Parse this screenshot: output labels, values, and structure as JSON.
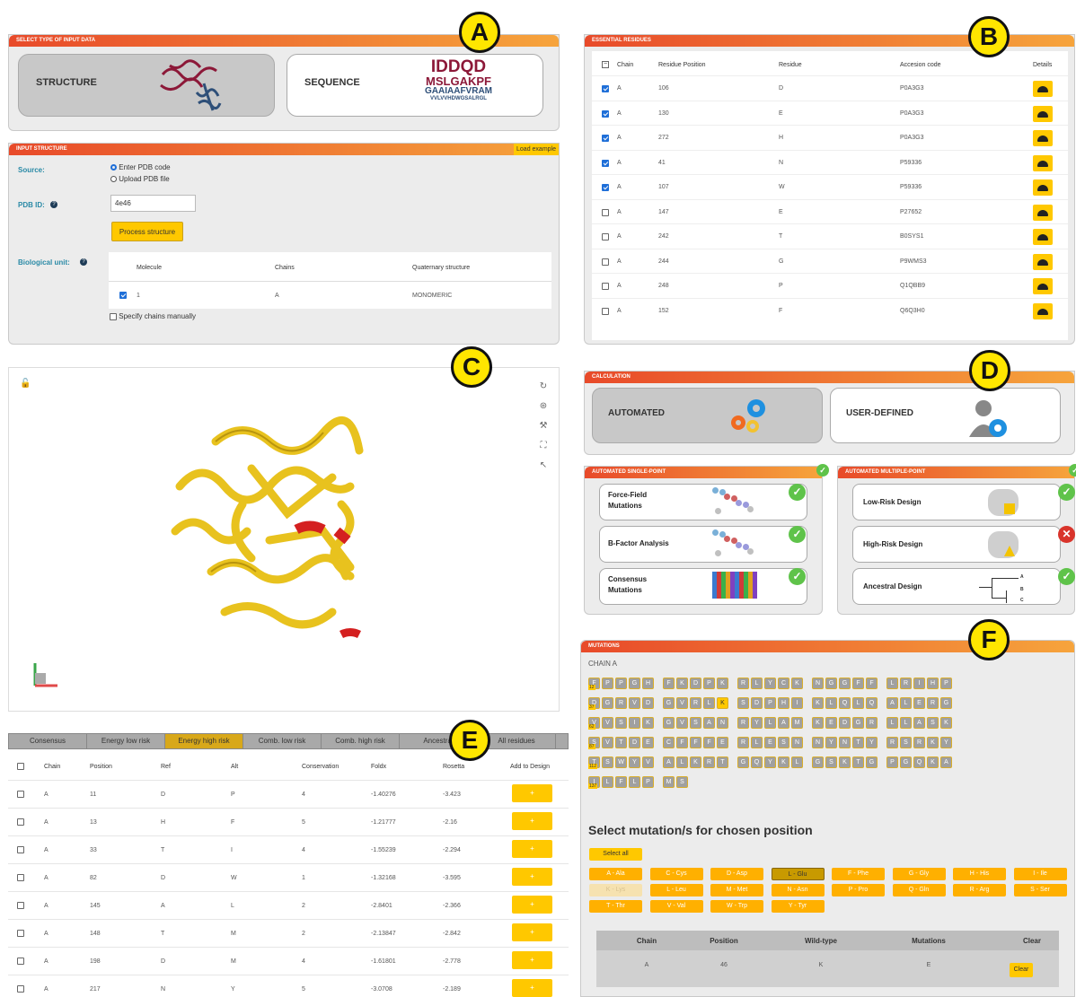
{
  "labels": {
    "a": "A",
    "b": "B",
    "c": "C",
    "d": "D",
    "e": "E",
    "f": "F"
  },
  "panelA": {
    "header": "SELECT TYPE OF INPUT DATA",
    "structure_label": "STRUCTURE",
    "sequence_label": "SEQUENCE",
    "seq_lines": [
      "IDDQD",
      "MSLGAKPF",
      "GAAIAAFVRAM",
      "VVLVVHDWGSALRGL"
    ]
  },
  "input": {
    "header": "INPUT STRUCTURE",
    "load_example": "Load example",
    "source_label": "Source:",
    "opt_pdb": "Enter PDB code",
    "opt_upload": "Upload PDB file",
    "pdb_label": "PDB ID:",
    "pdb_value": "4e46",
    "process_btn": "Process structure",
    "bio_label": "Biological unit:",
    "cols": [
      "Molecule",
      "Chains",
      "Quaternary structure"
    ],
    "row": [
      "1",
      "A",
      "MONOMERIC"
    ],
    "specify": "Specify chains manually"
  },
  "essential": {
    "header": "ESSENTIAL RESIDUES",
    "cols": [
      "Chain",
      "Residue Position",
      "Residue",
      "Accesion code",
      "Details"
    ],
    "rows": [
      [
        "A",
        "106",
        "D",
        "P0A3G3",
        true
      ],
      [
        "A",
        "130",
        "E",
        "P0A3G3",
        true
      ],
      [
        "A",
        "272",
        "H",
        "P0A3G3",
        true
      ],
      [
        "A",
        "41",
        "N",
        "P59336",
        true
      ],
      [
        "A",
        "107",
        "W",
        "P59336",
        true
      ],
      [
        "A",
        "147",
        "E",
        "P27652",
        false
      ],
      [
        "A",
        "242",
        "T",
        "B0SYS1",
        false
      ],
      [
        "A",
        "244",
        "G",
        "P9WMS3",
        false
      ],
      [
        "A",
        "248",
        "P",
        "Q1QBB9",
        false
      ],
      [
        "A",
        "152",
        "F",
        "Q6Q3H0",
        false
      ]
    ]
  },
  "calc": {
    "header": "CALCULATION",
    "automated": "AUTOMATED",
    "user": "USER-DEFINED",
    "single_header": "AUTOMATED SINGLE-POINT",
    "multi_header": "AUTOMATED MULTIPLE-POINT",
    "single": [
      [
        "Force-Field",
        "Mutations"
      ],
      [
        "B-Factor Analysis",
        ""
      ],
      [
        "Consensus",
        "Mutations"
      ]
    ],
    "multi": [
      "Low-Risk Design",
      "High-Risk Design",
      "Ancestral Design"
    ]
  },
  "tree_leaves": [
    "A",
    "B",
    "C"
  ],
  "tabs": [
    "Consensus",
    "Energy low risk",
    "Energy high risk",
    "Comb. low risk",
    "Comb. high risk",
    "Ancestral",
    "All residues"
  ],
  "mut_table": {
    "cols": [
      "Chain",
      "Position",
      "Ref",
      "Alt",
      "Conservation",
      "Foldx",
      "Rosetta",
      "Add to Design"
    ],
    "add": "+",
    "rows": [
      [
        "A",
        "11",
        "D",
        "P",
        "4",
        "-1.40276",
        "-3.423"
      ],
      [
        "A",
        "13",
        "H",
        "F",
        "5",
        "-1.21777",
        "-2.16"
      ],
      [
        "A",
        "33",
        "T",
        "I",
        "4",
        "-1.55239",
        "-2.294"
      ],
      [
        "A",
        "82",
        "D",
        "W",
        "1",
        "-1.32168",
        "-3.595"
      ],
      [
        "A",
        "145",
        "A",
        "L",
        "2",
        "-2.8401",
        "-2.366"
      ],
      [
        "A",
        "148",
        "T",
        "M",
        "2",
        "-2.13847",
        "-2.842"
      ],
      [
        "A",
        "198",
        "D",
        "M",
        "4",
        "-1.61801",
        "-2.778"
      ],
      [
        "A",
        "217",
        "N",
        "Y",
        "5",
        "-3.0708",
        "-2.189"
      ]
    ]
  },
  "mutations": {
    "header": "MUTATIONS",
    "chain": "CHAIN A",
    "rows": [
      {
        "num": "12",
        "groups": [
          "FPPGH",
          "FKDPK",
          "RLYCK",
          "NGGFF",
          "LRIHP"
        ]
      },
      {
        "num": "37",
        "groups": [
          "DGRVD",
          "GVRLK",
          "SDPHI",
          "KLQLQ",
          "ALERG"
        ]
      },
      {
        "num": "62",
        "groups": [
          "VVSIK",
          "GVSAN",
          "RYLAM",
          "KEDGR",
          "LLASK"
        ]
      },
      {
        "num": "87",
        "groups": [
          "SVTDE",
          "CFFFE",
          "RLESN",
          "NYNTY",
          "RSRKY"
        ]
      },
      {
        "num": "112",
        "groups": [
          "TSWYV",
          "ALKRT",
          "GQYKL",
          "GSKTG",
          "PGQKA"
        ]
      },
      {
        "num": "137",
        "groups": [
          "ILFLP",
          "MS"
        ]
      }
    ],
    "select_title": "Select mutation/s for chosen position",
    "select_all": "Select all",
    "aa": [
      "A - Ala",
      "C - Cys",
      "D - Asp",
      "L - Glu",
      "F - Phe",
      "G - Gly",
      "H - His",
      "I - Ile",
      "K - Lys",
      "L - Leu",
      "M - Met",
      "N - Asn",
      "P - Pro",
      "Q - Gln",
      "R - Arg",
      "S - Ser",
      "T - Thr",
      "V - Val",
      "W - Trp",
      "Y - Tyr"
    ],
    "sum_cols": [
      "Chain",
      "Position",
      "Wild-type",
      "Mutations",
      "Clear"
    ],
    "sum_row": [
      "A",
      "46",
      "K",
      "E"
    ],
    "clear": "Clear"
  },
  "colors": {
    "accent": "#ffc800",
    "header_start": "#e84a2a",
    "header_end": "#f6a43c",
    "protein": "#e8c21e",
    "highlight": "#d42020"
  }
}
